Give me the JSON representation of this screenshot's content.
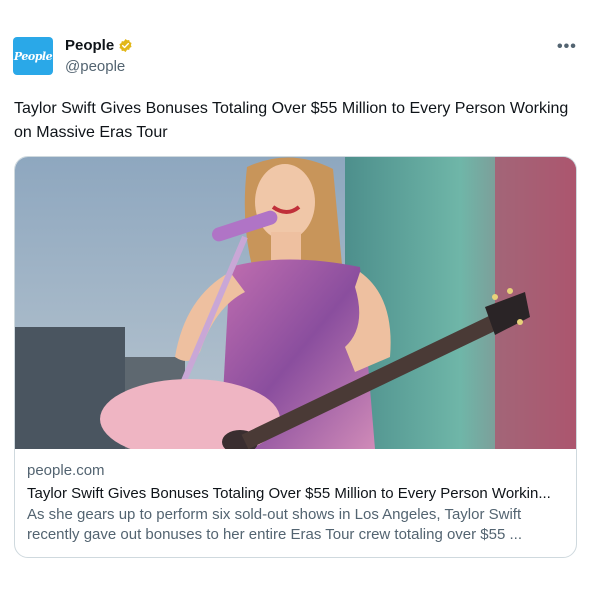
{
  "post": {
    "author_name": "People",
    "author_handle": "@people",
    "avatar_text": "People",
    "text": "Taylor Swift Gives Bonuses Totaling Over $55 Million to Every Person Working on Massive Eras Tour"
  },
  "card": {
    "domain": "people.com",
    "title": "Taylor Swift Gives Bonuses Totaling Over $55 Million to Every Person Workin...",
    "description": "As she gears up to perform six sold-out shows in Los Angeles, Taylor Swift recently gave out bonuses to her entire Eras Tour crew totaling over $55 ..."
  },
  "icons": {
    "verified": "verified-badge-icon",
    "more": "more-options-icon"
  },
  "colors": {
    "avatar_bg": "#2aa8e8",
    "verified_gold": "#e2b719",
    "muted_text": "#536471"
  }
}
